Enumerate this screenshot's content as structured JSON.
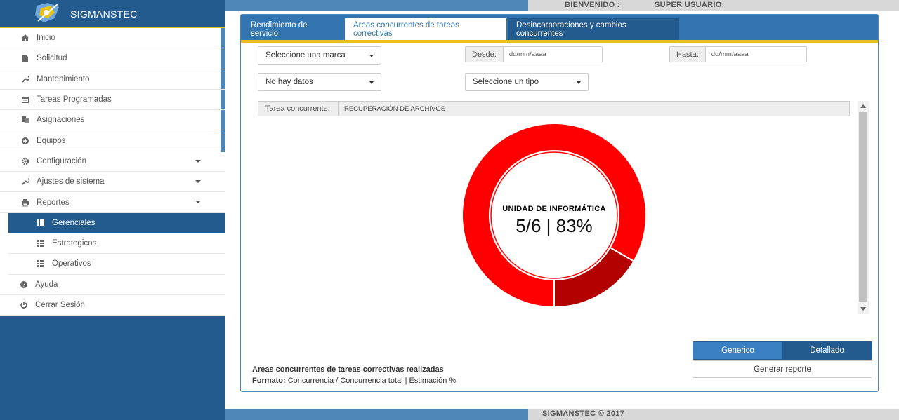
{
  "header": {
    "welcome_label": "BIENVENIDO :",
    "user_name": "SUPER USUARIO"
  },
  "brand": {
    "name": "SIGMANSTEC"
  },
  "sidebar": {
    "items": [
      {
        "label": "Inicio",
        "icon": "home-icon"
      },
      {
        "label": "Solicitud",
        "icon": "file-icon"
      },
      {
        "label": "Mantenimiento",
        "icon": "wrench-icon"
      },
      {
        "label": "Tareas Programadas",
        "icon": "calendar-icon"
      },
      {
        "label": "Asignaciones",
        "icon": "files-icon"
      },
      {
        "label": "Equipos",
        "icon": "plus-circle-icon"
      },
      {
        "label": "Configuración",
        "icon": "gear-icon"
      },
      {
        "label": "Ajustes de sistema",
        "icon": "wrench-icon"
      },
      {
        "label": "Reportes",
        "icon": "printer-icon"
      },
      {
        "label": "Gerenciales",
        "icon": "grid-icon"
      },
      {
        "label": "Estrategicos",
        "icon": "grid-icon"
      },
      {
        "label": "Operativos",
        "icon": "grid-icon"
      },
      {
        "label": "Ayuda",
        "icon": "question-icon"
      },
      {
        "label": "Cerrar Sesión",
        "icon": "power-icon"
      }
    ]
  },
  "tabs": [
    {
      "label": "Rendimiento de servicio"
    },
    {
      "label": "Areas concurrentes de tareas correctivas"
    },
    {
      "label": "Desincorporaciones y cambios concurrentes"
    }
  ],
  "filters": {
    "brand_select": "Seleccione una marca",
    "data_select": "No hay datos",
    "type_select": "Seleccione un tipo",
    "from_label": "Desde:",
    "from_placeholder": "dd/mm/aaaa",
    "to_label": "Hasta:",
    "to_placeholder": "dd/mm/aaaa"
  },
  "task": {
    "label": "Tarea concurrente:",
    "value": "RECUPERACIÓN DE ARCHIVOS"
  },
  "chart_data": {
    "type": "pie",
    "center_title": "UNIDAD DE INFORMÁTICA",
    "center_value": "5/6 | 83%",
    "slices": [
      {
        "label": "UNIDAD DE INFORMÁTICA",
        "value": 5,
        "color": "#ff0000"
      },
      {
        "label": "",
        "value": 1,
        "color": "#b30000"
      }
    ]
  },
  "actions": {
    "generic_label": "Generico",
    "detailed_label": "Detallado",
    "generate_label": "Generar reporte"
  },
  "description": {
    "title": "Areas concurrentes de tareas correctivas realizadas",
    "format_label": "Formato:",
    "format_value": "Concurrencia / Concurrencia total | Estimación %"
  },
  "footer": {
    "text": "SIGMANSTEC © 2017"
  },
  "colors": {
    "primary": "#245b8f",
    "accent": "#e8c21a",
    "chart_main": "#ff0000",
    "chart_secondary": "#b30000"
  }
}
